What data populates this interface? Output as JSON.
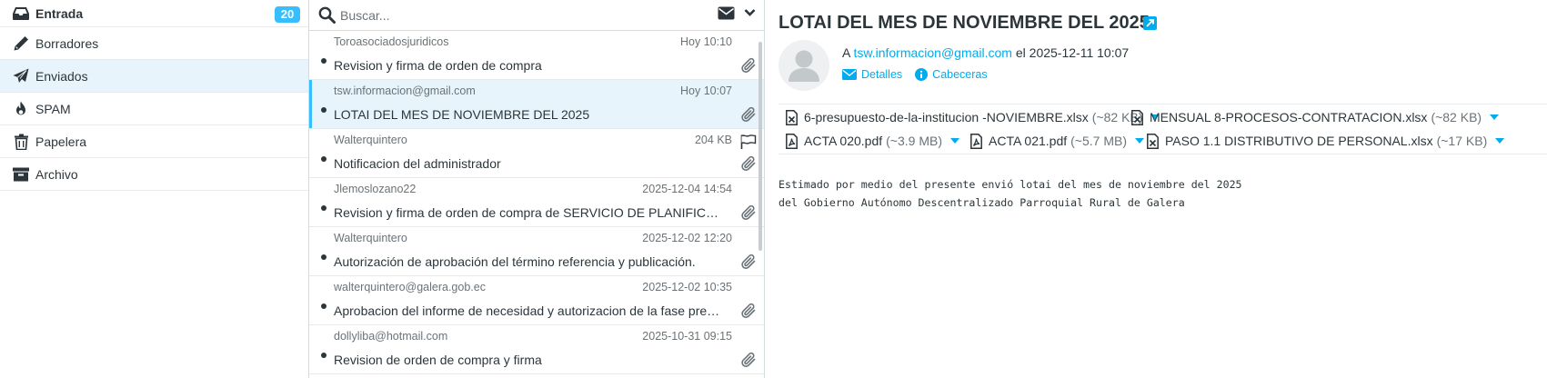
{
  "folders": [
    {
      "label": "Entrada",
      "icon": "inbox-icon",
      "badge": "20"
    },
    {
      "label": "Borradores",
      "icon": "pencil-icon"
    },
    {
      "label": "Enviados",
      "icon": "paper-plane-icon"
    },
    {
      "label": "SPAM",
      "icon": "fire-icon"
    },
    {
      "label": "Papelera",
      "icon": "trash-icon"
    },
    {
      "label": "Archivo",
      "icon": "archive-box-icon"
    }
  ],
  "search": {
    "placeholder": "Buscar..."
  },
  "messages": [
    {
      "from": "Toroasociadosjuridicos",
      "date": "Hoy 10:10",
      "subject": "Revision y firma de orden de compra"
    },
    {
      "from": "tsw.informacion@gmail.com",
      "date": "Hoy 10:07",
      "subject": "LOTAI DEL MES DE NOVIEMBRE DEL 2025"
    },
    {
      "from": "Walterquintero",
      "date": "204 KB",
      "subject": "Notificacion del administrador"
    },
    {
      "from": "Jlemoslozano22",
      "date": "2025-12-04 14:54",
      "subject": "Revision y firma de orden de compra de SERVICIO DE PLANIFICACIÓN"
    },
    {
      "from": "Walterquintero",
      "date": "2025-12-02 12:20",
      "subject": "Autorización de aprobación del término referencia y publicación."
    },
    {
      "from": "walterquintero@galera.gob.ec",
      "date": "2025-12-02 10:35",
      "subject": "Aprobacion del informe de necesidad y autorizacion de la fase preparatoria"
    },
    {
      "from": "dollyliba@hotmail.com",
      "date": "2025-10-31 09:15",
      "subject": "Revision de orden de compra y firma"
    }
  ],
  "view": {
    "title": "LOTAI DEL MES DE NOVIEMBRE DEL 2025",
    "to_prefix": "A",
    "to_address": "tsw.informacion@gmail.com",
    "date_prefix": "el",
    "date": "2025-12-11 10:07",
    "details_label": "Detalles",
    "headers_label": "Cabeceras",
    "attachments": [
      {
        "name": "6-presupuesto-de-la-institucion -NOVIEMBRE.xlsx",
        "size": "(~82 KB)",
        "icon": "spreadsheet-file-icon"
      },
      {
        "name": "MENSUAL 8-PROCESOS-CONTRATACION.xlsx",
        "size": "(~82 KB)",
        "icon": "spreadsheet-file-icon"
      },
      {
        "name": "ACTA 020.pdf",
        "size": "(~3.9 MB)",
        "icon": "pdf-file-icon"
      },
      {
        "name": "ACTA 021.pdf",
        "size": "(~5.7 MB)",
        "icon": "pdf-file-icon"
      },
      {
        "name": "PASO 1.1 DISTRIBUTIVO DE PERSONAL.xlsx",
        "size": "(~17 KB)",
        "icon": "spreadsheet-file-icon"
      }
    ],
    "body": [
      "Estimado por medio del presente envió lotai del mes de noviembre del 2025",
      "del Gobierno Autónomo Descentralizado Parroquial Rural de Galera"
    ]
  },
  "colors": {
    "accent": "#37beff",
    "link": "#00aced",
    "selected_bg": "#e8f4fb",
    "text": "#2c363a"
  }
}
